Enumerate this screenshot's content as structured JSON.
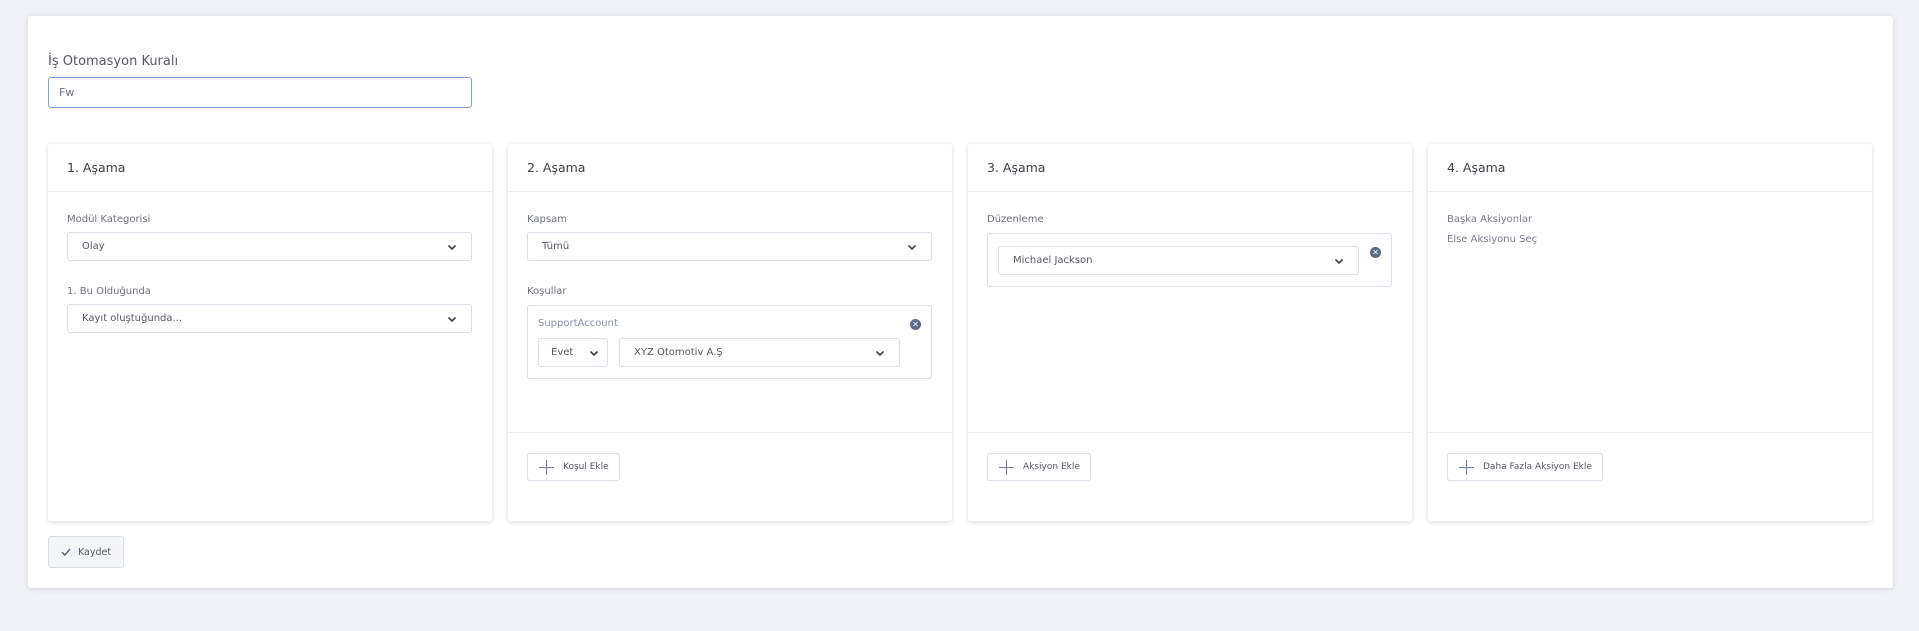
{
  "rule": {
    "label": "İş Otomasyon Kuralı",
    "value": "Fw"
  },
  "stages": {
    "s1": {
      "title": "1. Aşama",
      "module_label": "Modül Kategorisi",
      "module_value": "Olay",
      "when_label": "1. Bu Olduğunda",
      "when_value": "Kayıt oluştuğunda..."
    },
    "s2": {
      "title": "2. Aşama",
      "scope_label": "Kapsam",
      "scope_value": "Tümü",
      "conditions_label": "Koşullar",
      "condition_field": "SupportAccount",
      "condition_operator": "Evet",
      "condition_value": "XYZ Otomotiv A.Ş",
      "add_button": "Koşul Ekle"
    },
    "s3": {
      "title": "3. Aşama",
      "edit_label": "Düzenleme",
      "edit_value": "Michael Jackson",
      "add_button": "Aksiyon Ekle"
    },
    "s4": {
      "title": "4. Aşama",
      "other_actions": "Başka Aksiyonlar",
      "else_action": "Else Aksiyonu Seç",
      "add_button": "Daha Fazla Aksiyon Ekle"
    }
  },
  "save_label": "Kaydet",
  "colors": {
    "accent": "#7aa2dc",
    "icon": "#5b6b8c",
    "background": "#f1f2f7"
  }
}
